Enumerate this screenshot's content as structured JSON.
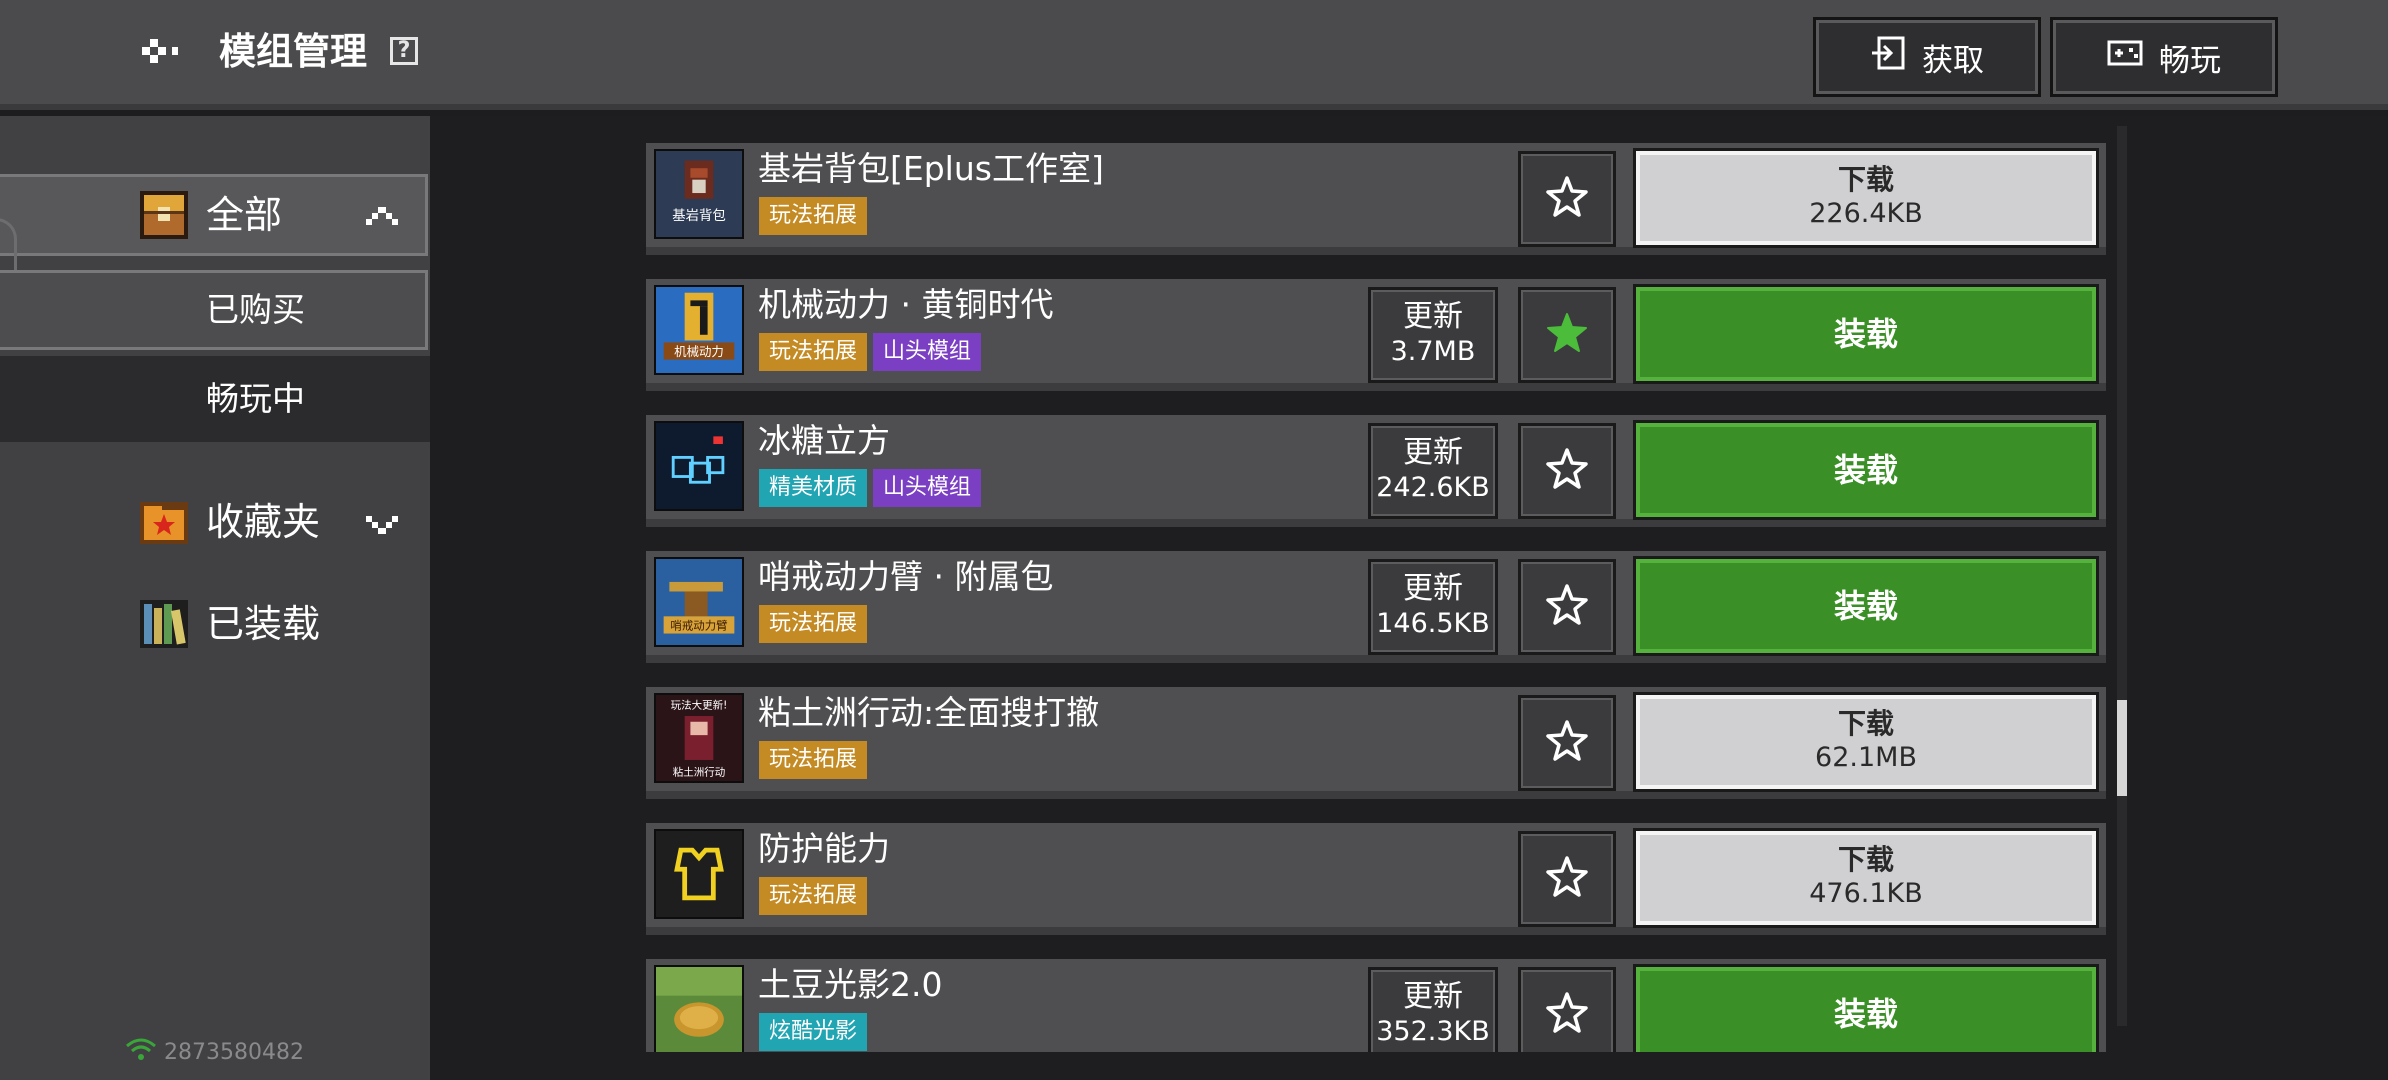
{
  "header": {
    "title": "模组管理",
    "help_label": "?",
    "get_button": "获取",
    "play_button": "畅玩",
    "icons": [
      "back-arrow-icon",
      "help-icon",
      "import-icon",
      "gamepad-icon"
    ]
  },
  "sidebar": {
    "all_label": "全部",
    "purchased_label": "已购买",
    "playing_label": "畅玩中",
    "favorites_label": "收藏夹",
    "installed_label": "已装载",
    "user_id": "2873580482"
  },
  "colors": {
    "header_bg": "#4b4b4d",
    "sidebar_bg": "#414143",
    "row_bg": "#4f4f51",
    "load_green": "#3a8f26",
    "download_gray": "#d0d0d2",
    "tag_orange": "#c48a24",
    "tag_purple": "#7a3fc2",
    "tag_cyan": "#21a5b3",
    "star_filled": "#4bbd3a"
  },
  "mods": [
    {
      "title": "基岩背包[Eplus工作室]",
      "tags": [
        {
          "label": "玩法拓展",
          "color": "orange"
        }
      ],
      "update": null,
      "favorited": false,
      "action": {
        "type": "download",
        "label": "下载",
        "size": "226.4KB"
      }
    },
    {
      "title": "机械动力 · 黄铜时代",
      "tags": [
        {
          "label": "玩法拓展",
          "color": "orange"
        },
        {
          "label": "山头模组",
          "color": "purple"
        }
      ],
      "update": {
        "label": "更新",
        "size": "3.7MB"
      },
      "favorited": true,
      "action": {
        "type": "load",
        "label": "装载"
      }
    },
    {
      "title": "冰糖立方",
      "tags": [
        {
          "label": "精美材质",
          "color": "cyan"
        },
        {
          "label": "山头模组",
          "color": "purple"
        }
      ],
      "update": {
        "label": "更新",
        "size": "242.6KB"
      },
      "favorited": false,
      "action": {
        "type": "load",
        "label": "装载"
      }
    },
    {
      "title": "哨戒动力臂 · 附属包",
      "tags": [
        {
          "label": "玩法拓展",
          "color": "orange"
        }
      ],
      "update": {
        "label": "更新",
        "size": "146.5KB"
      },
      "favorited": false,
      "action": {
        "type": "load",
        "label": "装载"
      }
    },
    {
      "title": "粘土洲行动:全面搜打撤",
      "tags": [
        {
          "label": "玩法拓展",
          "color": "orange"
        }
      ],
      "update": null,
      "favorited": false,
      "action": {
        "type": "download",
        "label": "下载",
        "size": "62.1MB"
      }
    },
    {
      "title": "防护能力",
      "tags": [
        {
          "label": "玩法拓展",
          "color": "orange"
        }
      ],
      "update": null,
      "favorited": false,
      "action": {
        "type": "download",
        "label": "下载",
        "size": "476.1KB"
      }
    },
    {
      "title": "土豆光影2.0",
      "tags": [
        {
          "label": "炫酷光影",
          "color": "cyan"
        }
      ],
      "update": {
        "label": "更新",
        "size": "352.3KB"
      },
      "favorited": false,
      "action": {
        "type": "load",
        "label": "装载"
      }
    }
  ],
  "thumbnail_text": {
    "mod_0": "基岩背包",
    "mod_1": "机械动力",
    "mod_3": "哨戒动力臂",
    "mod_4_top": "玩法大更新!",
    "mod_4_bottom": "粘土洲行动"
  }
}
